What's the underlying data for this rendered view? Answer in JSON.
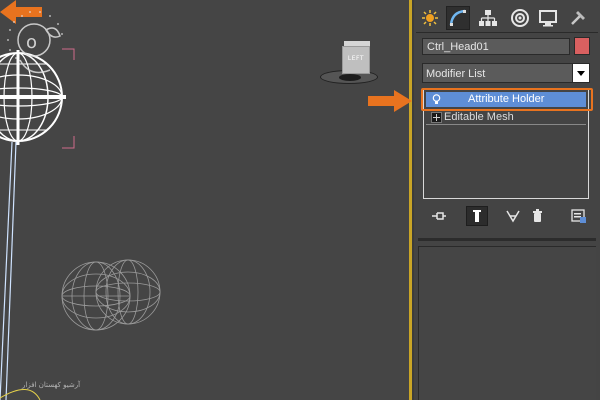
{
  "viewport": {
    "viewcube_label": "LEFT",
    "watermark_text": "آرشیو کهستان افزار"
  },
  "command_panel": {
    "tabs": [
      {
        "name": "create-tab",
        "icon": "create-icon"
      },
      {
        "name": "modify-tab",
        "icon": "modify-icon"
      },
      {
        "name": "hierarchy-tab",
        "icon": "hierarchy-icon"
      },
      {
        "name": "motion-tab",
        "icon": "motion-icon"
      },
      {
        "name": "display-tab",
        "icon": "display-icon"
      },
      {
        "name": "utilities-tab",
        "icon": "hammer-icon"
      }
    ],
    "object_name": "Ctrl_Head01",
    "object_color": "#d96060",
    "modifier_list_label": "Modifier List",
    "modifier_stack": [
      {
        "label": "Attribute Holder",
        "icon": "lightbulb-icon",
        "selected": true
      },
      {
        "label": "Editable Mesh",
        "icon": "mesh-icon",
        "selected": false
      }
    ],
    "stack_tools": [
      "pin-stack-icon",
      "show-end-result-icon",
      "make-unique-icon",
      "remove-modifier-icon",
      "configure-sets-icon"
    ]
  },
  "colors": {
    "selection": "#5e8ed6",
    "annotation_arrow": "#e8731f",
    "viewport_border": "#c9a526"
  }
}
